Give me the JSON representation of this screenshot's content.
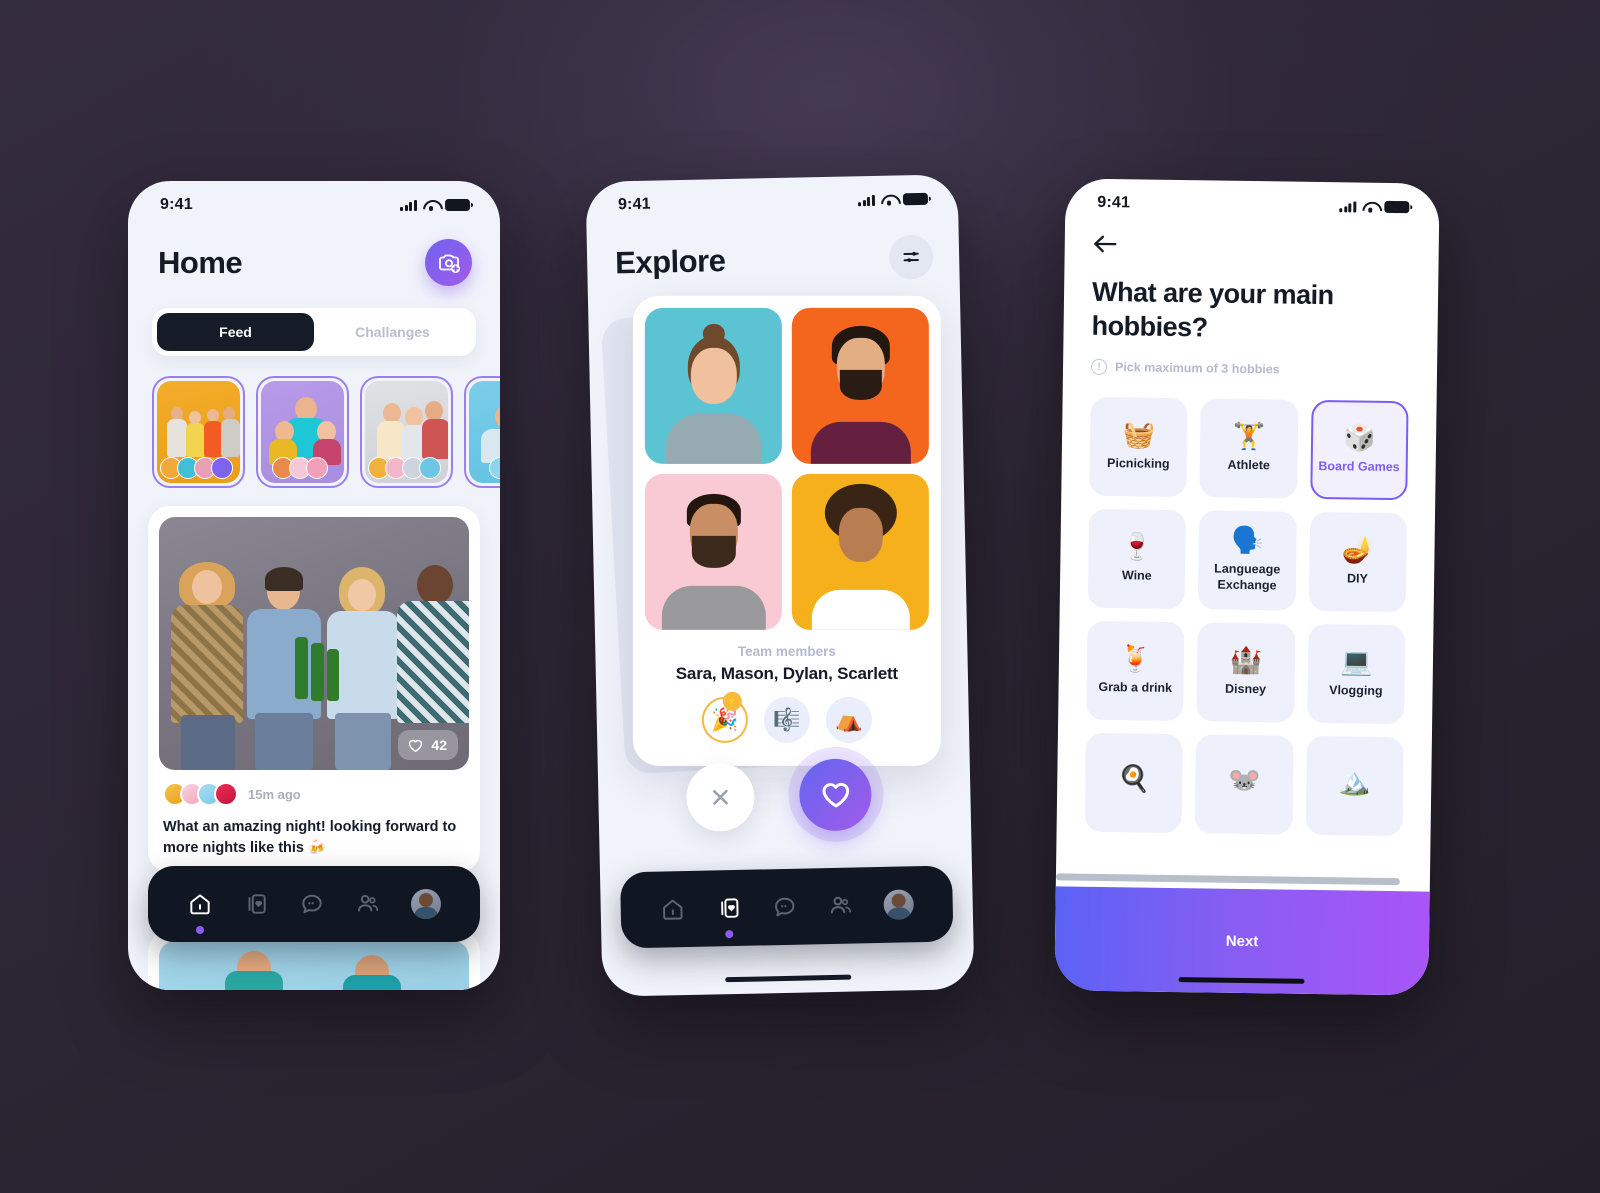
{
  "background": {
    "color_from": "#342c3f",
    "color_to": "#241f2b"
  },
  "accent": {
    "purple": "#7b5cf5",
    "violet": "#a25ae8",
    "dark": "#111722"
  },
  "status_bar": {
    "time": "9:41",
    "signal_icon": "cellular-signal-icon",
    "wifi_icon": "wifi-icon",
    "battery_icon": "battery-icon"
  },
  "phone1": {
    "title": "Home",
    "fab_icon": "camera-add-icon",
    "tabs": [
      {
        "label": "Feed",
        "active": true
      },
      {
        "label": "Challanges",
        "active": false
      }
    ],
    "stories": [
      {
        "name": "story-card-1",
        "bg": "#f0a520",
        "avatars": [
          "#f2a93b",
          "#3fc0d8",
          "#e9a0b6",
          "#7e63ef"
        ]
      },
      {
        "name": "story-card-2",
        "bg": "#a98de0",
        "avatars": [
          "#e78a4a",
          "#f6c7d6",
          "#f0a0b8"
        ]
      },
      {
        "name": "story-card-3",
        "bg": "#d6d7da",
        "avatars": [
          "#f0b23c",
          "#f3b6cb",
          "#cfd3dd",
          "#6ec6e6"
        ]
      },
      {
        "name": "story-card-4",
        "bg": "#6ec6e6",
        "avatars": [
          "#8ed4ea",
          "#cfd6e2"
        ]
      }
    ],
    "post": {
      "image_alt": "four-friends-toasting-beer-bottles",
      "like_icon": "heart-icon",
      "like_count": "42",
      "avatars": [
        "#f5b62c",
        "#f6bed0",
        "#8fd4ef",
        "#e0214c"
      ],
      "timestamp": "15m ago",
      "caption": "What an amazing night! looking forward to more nights like this 🍻"
    },
    "nav": [
      {
        "name": "nav-home",
        "icon": "home-icon",
        "active": true
      },
      {
        "name": "nav-cards",
        "icon": "cards-icon",
        "active": false
      },
      {
        "name": "nav-chat",
        "icon": "chat-icon",
        "active": false
      },
      {
        "name": "nav-people",
        "icon": "people-icon",
        "active": false
      },
      {
        "name": "nav-profile",
        "icon": "avatar-icon",
        "active": false
      }
    ]
  },
  "phone2": {
    "title": "Explore",
    "filter_icon": "filter-sliders-icon",
    "photos": [
      {
        "name": "member-photo-1",
        "bg": "#5cc3d2",
        "shirt": "#8fa4ad"
      },
      {
        "name": "member-photo-2",
        "bg": "#f4661e",
        "shirt": "#66203f"
      },
      {
        "name": "member-photo-3",
        "bg": "#f9c9d4",
        "shirt": "#9a9a9c"
      },
      {
        "name": "member-photo-4",
        "bg": "#f5b01c",
        "shirt": "#ffffff"
      }
    ],
    "team_label": "Team members",
    "team_names": "Sara, Mason, Dylan, Scarlett",
    "badges": [
      {
        "name": "badge-party",
        "emoji": "🎉",
        "highlighted": true,
        "spark": "⚡"
      },
      {
        "name": "badge-music",
        "emoji": "🎼",
        "highlighted": false
      },
      {
        "name": "badge-camping",
        "emoji": "⛺",
        "highlighted": false
      }
    ],
    "actions": [
      {
        "name": "pass-button",
        "icon": "close-icon"
      },
      {
        "name": "like-button",
        "icon": "heart-icon"
      }
    ],
    "nav": [
      {
        "name": "nav-home",
        "icon": "home-icon",
        "active": false
      },
      {
        "name": "nav-cards",
        "icon": "cards-icon",
        "active": true
      },
      {
        "name": "nav-chat",
        "icon": "chat-icon",
        "active": false
      },
      {
        "name": "nav-people",
        "icon": "people-icon",
        "active": false
      },
      {
        "name": "nav-profile",
        "icon": "avatar-icon",
        "active": false
      }
    ]
  },
  "phone3": {
    "back_icon": "arrow-left-icon",
    "question": "What are your main hobbies?",
    "hint_icon": "info-icon",
    "hint": "Pick maximum of 3 hobbies",
    "hobbies": [
      {
        "label": "Picnicking",
        "emoji": "🧺",
        "selected": false
      },
      {
        "label": "Athlete",
        "emoji": "🏋️",
        "selected": false
      },
      {
        "label": "Board Games",
        "emoji": "🎲",
        "selected": true
      },
      {
        "label": "Wine",
        "emoji": "🍷",
        "selected": false
      },
      {
        "label": "Langueage Exchange",
        "emoji": "🗣️",
        "selected": false
      },
      {
        "label": "DIY",
        "emoji": "🪔",
        "selected": false
      },
      {
        "label": "Grab a drink",
        "emoji": "🍹",
        "selected": false
      },
      {
        "label": "Disney",
        "emoji": "🏰",
        "selected": false
      },
      {
        "label": "Vlogging",
        "emoji": "💻",
        "selected": false
      },
      {
        "label": "",
        "emoji": "🍳",
        "selected": false
      },
      {
        "label": "",
        "emoji": "🐭",
        "selected": false
      },
      {
        "label": "",
        "emoji": "🏔️",
        "selected": false
      }
    ],
    "next_label": "Next"
  }
}
